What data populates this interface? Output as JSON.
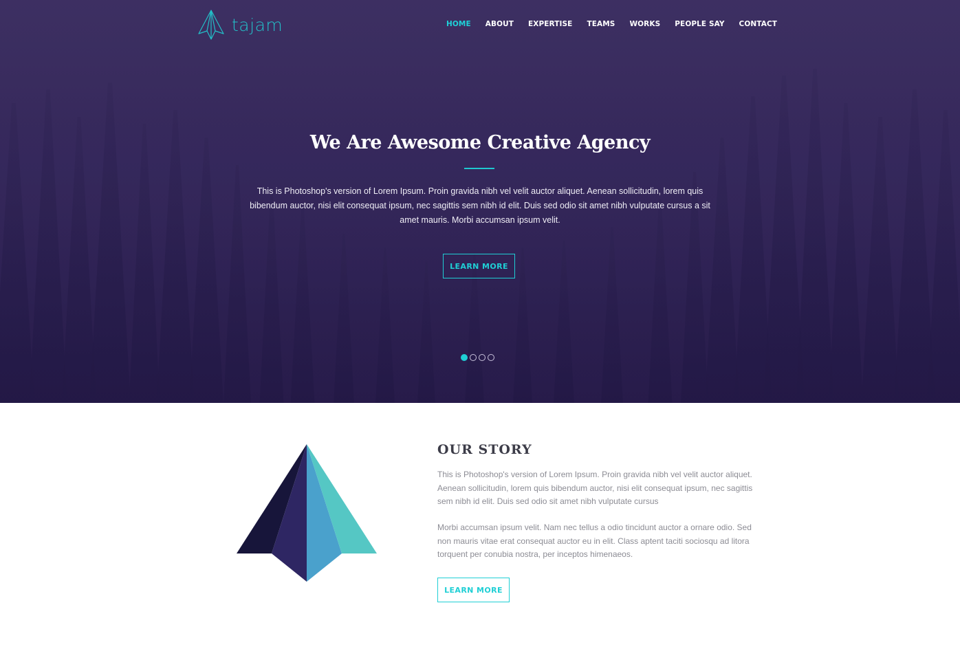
{
  "brand": {
    "name": "tajam",
    "accent_color": "#1fcfd5"
  },
  "nav": {
    "items": [
      {
        "label": "HOME",
        "active": true
      },
      {
        "label": "ABOUT",
        "active": false
      },
      {
        "label": "EXPERTISE",
        "active": false
      },
      {
        "label": "TEAMS",
        "active": false
      },
      {
        "label": "WORKS",
        "active": false
      },
      {
        "label": "PEOPLE SAY",
        "active": false
      },
      {
        "label": "CONTACT",
        "active": false
      }
    ]
  },
  "hero": {
    "title": "We Are Awesome Creative Agency",
    "text": "This is Photoshop's version  of Lorem Ipsum. Proin gravida nibh vel velit auctor aliquet. Aenean sollicitudin, lorem quis bibendum auctor, nisi elit consequat ipsum, nec sagittis sem nibh id elit. Duis sed odio sit amet nibh vulputate cursus a sit amet mauris. Morbi accumsan ipsum velit.",
    "button_label": "LEARN MORE",
    "slides": {
      "count": 4,
      "active_index": 0
    }
  },
  "story": {
    "title": "OUR STORY",
    "paragraph_1": "This is Photoshop's version  of Lorem Ipsum. Proin gravida nibh vel velit auctor aliquet. Aenean sollicitudin, lorem quis bibendum auctor, nisi elit consequat ipsum, nec sagittis sem nibh id elit. Duis sed odio sit amet nibh vulputate cursus",
    "paragraph_2": "Morbi accumsan ipsum velit. Nam nec tellus a odio tincidunt auctor a ornare odio. Sed non  mauris vitae erat consequat auctor eu in elit. Class aptent taciti sociosqu ad litora torquent per conubia nostra, per inceptos himenaeos.",
    "button_label": "LEARN MORE",
    "graphic_colors": [
      "#17153a",
      "#2e2663",
      "#4aa1cc",
      "#55c7c4"
    ]
  }
}
